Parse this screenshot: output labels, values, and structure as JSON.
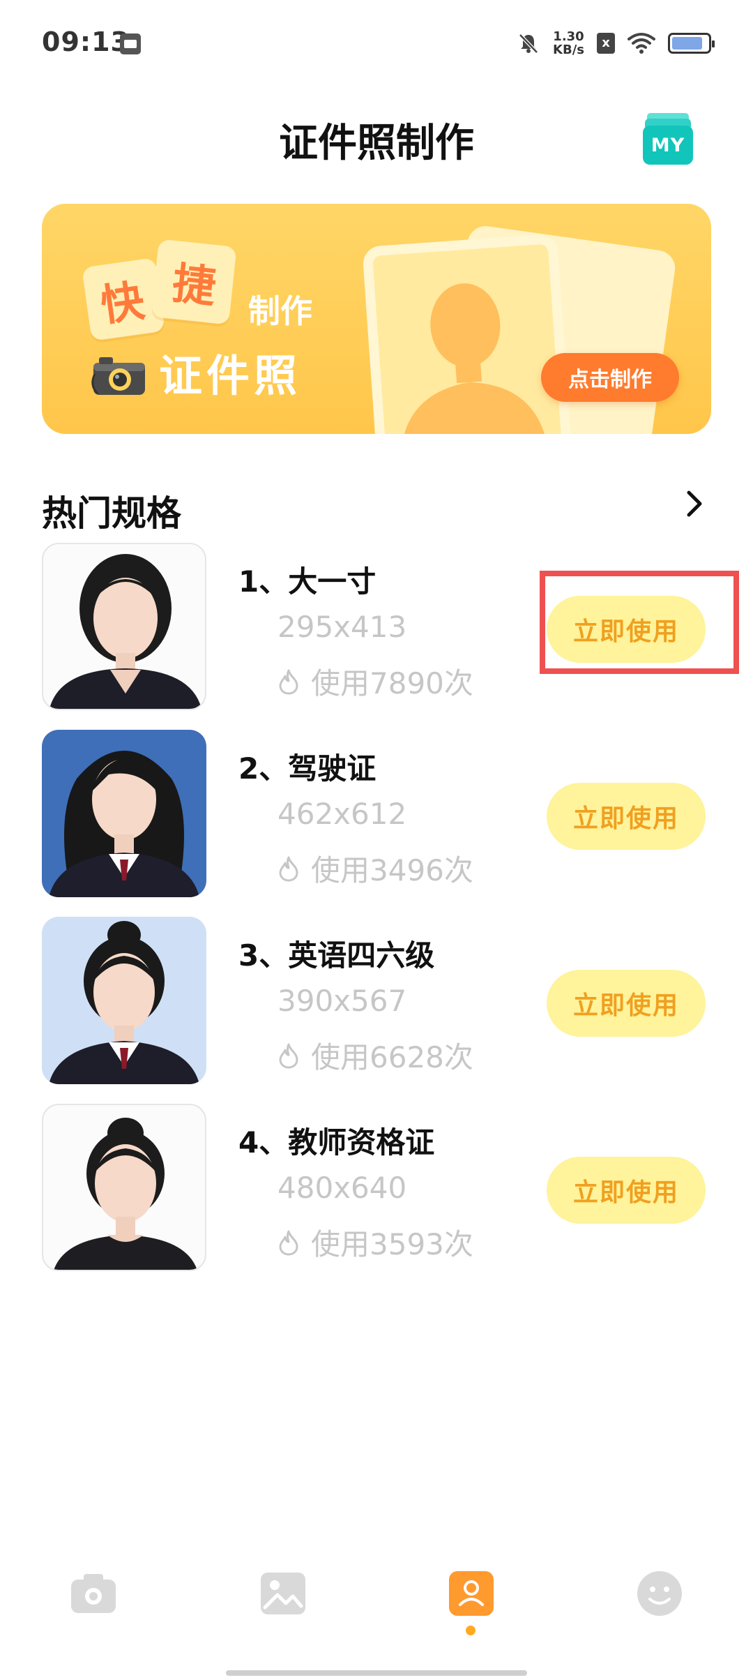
{
  "status_bar": {
    "time": "09:13",
    "net_speed_value": "1.30",
    "net_speed_unit": "KB/s",
    "sim_status": "x",
    "battery_level": 0.85
  },
  "header": {
    "title": "证件照制作",
    "my_button_label": "MY"
  },
  "banner": {
    "char_1": "快",
    "char_2": "捷",
    "make_text": "制作",
    "photo_text": "证件照",
    "cta_label": "点击制作"
  },
  "section": {
    "title": "热门规格"
  },
  "specs": [
    {
      "name": "1、大一寸",
      "size": "295x413",
      "usage": "使用7890次",
      "button": "立即使用"
    },
    {
      "name": "2、驾驶证",
      "size": "462x612",
      "usage": "使用3496次",
      "button": "立即使用"
    },
    {
      "name": "3、英语四六级",
      "size": "390x567",
      "usage": "使用6628次",
      "button": "立即使用"
    },
    {
      "name": "4、教师资格证",
      "size": "480x640",
      "usage": "使用3593次",
      "button": "立即使用"
    }
  ],
  "colors": {
    "accent_orange": "#ff7b2e",
    "button_bg": "#fff39b",
    "button_text": "#f0a020",
    "highlight": "#ef5050",
    "my_teal": "#12c5bb"
  },
  "bottom_nav": {
    "items": [
      "camera-icon",
      "gallery-icon",
      "id-photo-icon",
      "smiley-icon"
    ],
    "active_index": 2
  }
}
